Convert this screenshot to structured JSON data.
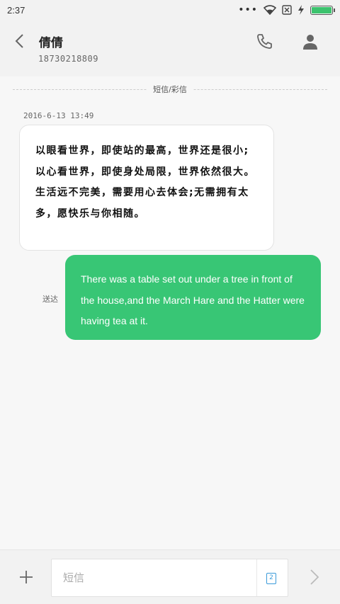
{
  "status_bar": {
    "time": "2:37",
    "dots": "•••",
    "icons": [
      "wifi-icon",
      "sim-x-icon",
      "charging-icon",
      "battery-icon"
    ],
    "battery_percent": 100,
    "battery_color": "#3cc36e"
  },
  "header": {
    "contact_name": "倩倩",
    "contact_number": "18730218809"
  },
  "conversation": {
    "mode_label": "短信/彩信",
    "timestamp": "2016-6-13 13:49",
    "incoming_message": "以眼看世界，即使站的最高，世界还是很小;以心看世界，即使身处局限，世界依然很大。生活远不完美，需要用心去体会;无需拥有太多，愿快乐与你相随。",
    "sent_status": "送达",
    "outgoing_message": "There was a table set out under a tree in front of the house,and the March Hare and the Hatter were having tea at it.",
    "outgoing_color": "#38c675"
  },
  "compose": {
    "placeholder": "短信",
    "sim_label": "2"
  }
}
